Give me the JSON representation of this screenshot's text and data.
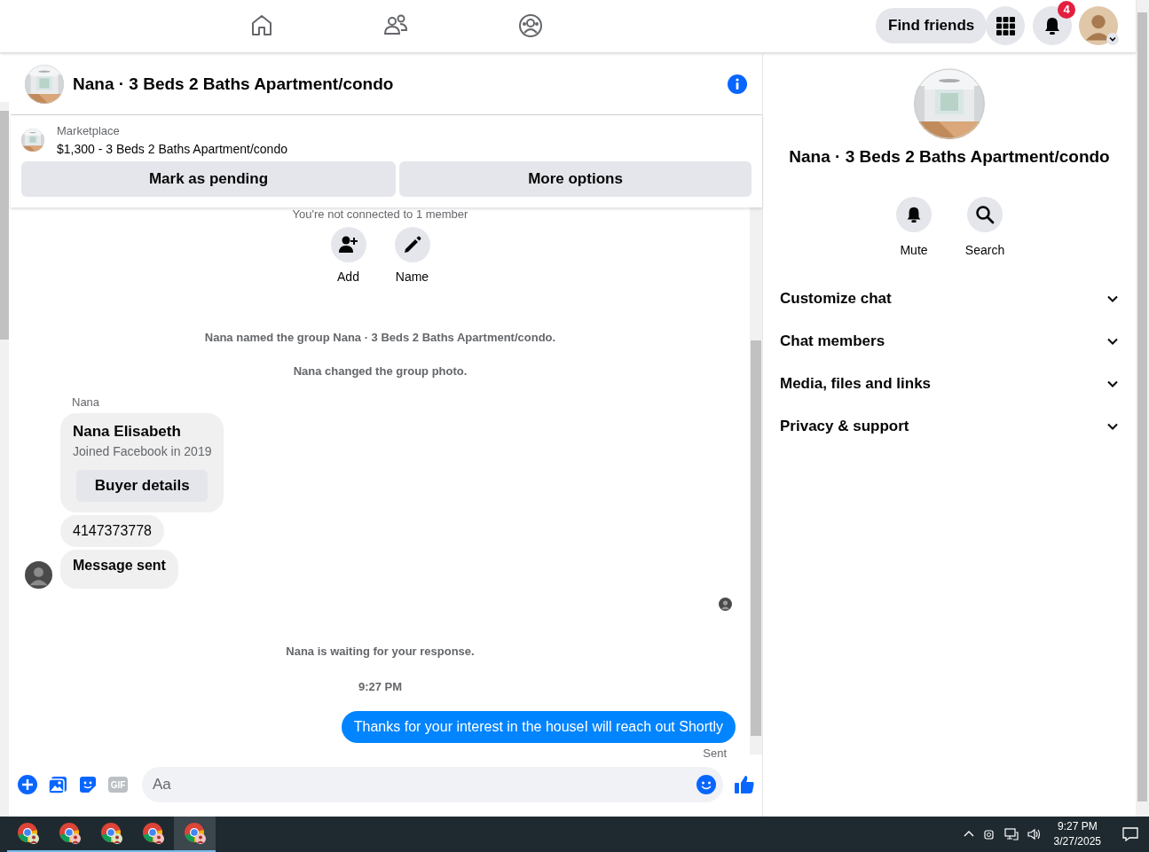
{
  "top_nav": {
    "tabs": [
      {
        "kind": "home"
      },
      {
        "kind": "friends"
      },
      {
        "kind": "groups"
      }
    ],
    "find_friends": "Find friends",
    "notification_count": "4"
  },
  "chat": {
    "title": "Nana · 3 Beds 2 Baths Apartment/condo",
    "listing": {
      "source": "Marketplace",
      "summary": "$1,300 - 3 Beds 2 Baths Apartment/condo",
      "buttons": [
        "Mark as pending",
        "More options"
      ]
    },
    "messages": [
      {
        "kind": "notice",
        "text": "You're not connected to 1 member"
      },
      {
        "kind": "actions",
        "items": [
          {
            "label": "Add"
          },
          {
            "label": "Name"
          }
        ]
      },
      {
        "kind": "event",
        "text": "Nana named the group Nana · 3 Beds 2 Baths Apartment/condo."
      },
      {
        "kind": "event",
        "text": "Nana changed the group photo."
      },
      {
        "kind": "sender",
        "text": "Nana"
      },
      {
        "kind": "profile_card",
        "title": "Nana Elisabeth",
        "subtitle": "Joined Facebook in 2019",
        "button": "Buyer details"
      },
      {
        "kind": "incoming",
        "text": "4147373778",
        "avatar": false
      },
      {
        "kind": "incoming",
        "text": "Message sent",
        "avatar": true
      },
      {
        "kind": "read_receipt"
      },
      {
        "kind": "event",
        "text": "Nana is waiting for your response."
      },
      {
        "kind": "time",
        "text": "9:27 PM"
      },
      {
        "kind": "outgoing",
        "text": "Thanks for your interest in the houseI will reach out Shortly",
        "status": "Sent"
      }
    ],
    "composer": {
      "gif": "GIF",
      "placeholder": "Aa"
    }
  },
  "details": {
    "title": "Nana · 3 Beds 2 Baths Apartment/condo",
    "actions": [
      {
        "label": "Mute"
      },
      {
        "label": "Search"
      }
    ],
    "sections": [
      {
        "label": "Customize chat",
        "expanded": false
      },
      {
        "label": "Chat members",
        "expanded": false
      },
      {
        "label": "Media, files and links",
        "expanded": false
      },
      {
        "label": "Privacy & support",
        "expanded": false
      }
    ]
  },
  "taskbar": {
    "apps": [
      {
        "selected": false
      },
      {
        "selected": false
      },
      {
        "selected": false
      },
      {
        "selected": false
      },
      {
        "selected": true
      }
    ],
    "time": "9:27 PM",
    "date": "3/27/2025"
  }
}
